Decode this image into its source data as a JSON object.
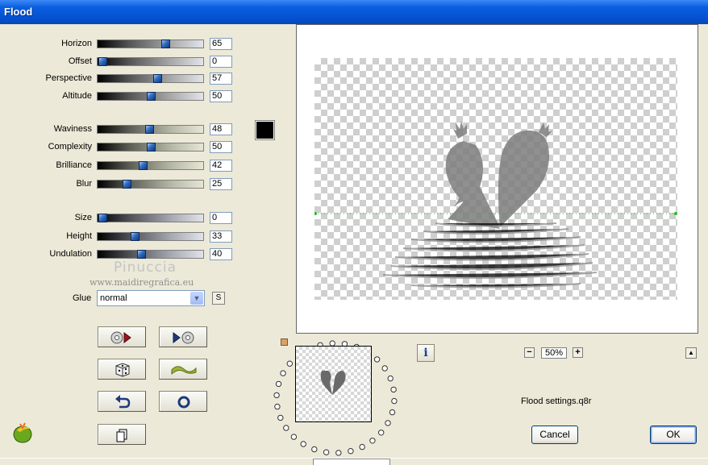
{
  "window": {
    "title": "Flood"
  },
  "sliders": [
    {
      "id": "horizon",
      "label": "Horizon",
      "value": 65,
      "max": 100
    },
    {
      "id": "offset",
      "label": "Offset",
      "value": 0,
      "max": 100
    },
    {
      "id": "perspective",
      "label": "Perspective",
      "value": 57,
      "max": 100
    },
    {
      "id": "altitude",
      "label": "Altitude",
      "value": 50,
      "max": 100
    },
    {
      "id": "waviness",
      "label": "Waviness",
      "value": 48,
      "max": 100
    },
    {
      "id": "complexity",
      "label": "Complexity",
      "value": 50,
      "max": 100
    },
    {
      "id": "brilliance",
      "label": "Brilliance",
      "value": 42,
      "max": 100
    },
    {
      "id": "blur",
      "label": "Blur",
      "value": 25,
      "max": 100
    },
    {
      "id": "size",
      "label": "Size",
      "value": 0,
      "max": 100
    },
    {
      "id": "height",
      "label": "Height",
      "value": 33,
      "max": 100
    },
    {
      "id": "undulation",
      "label": "Undulation",
      "value": 40,
      "max": 100
    }
  ],
  "color": {
    "swatch": "#000000",
    "accent": "#0552d2"
  },
  "watermark": {
    "name": "Pinuccia",
    "url": "www.maidiregrafica.eu"
  },
  "glue": {
    "label": "Glue",
    "value": "normal",
    "s_button": "S"
  },
  "toolbar_icons": [
    "load-preset-icon",
    "save-preset-icon",
    "random-dice-icon",
    "wave-icon",
    "undo-icon",
    "reset-icon",
    "copy-icon"
  ],
  "zoom": {
    "minus": "−",
    "value": "50%",
    "plus": "+"
  },
  "info_button": "i",
  "collapse_button": "▲",
  "settings_file": "Flood settings.q8r",
  "buttons": {
    "cancel": "Cancel",
    "ok": "OK"
  }
}
